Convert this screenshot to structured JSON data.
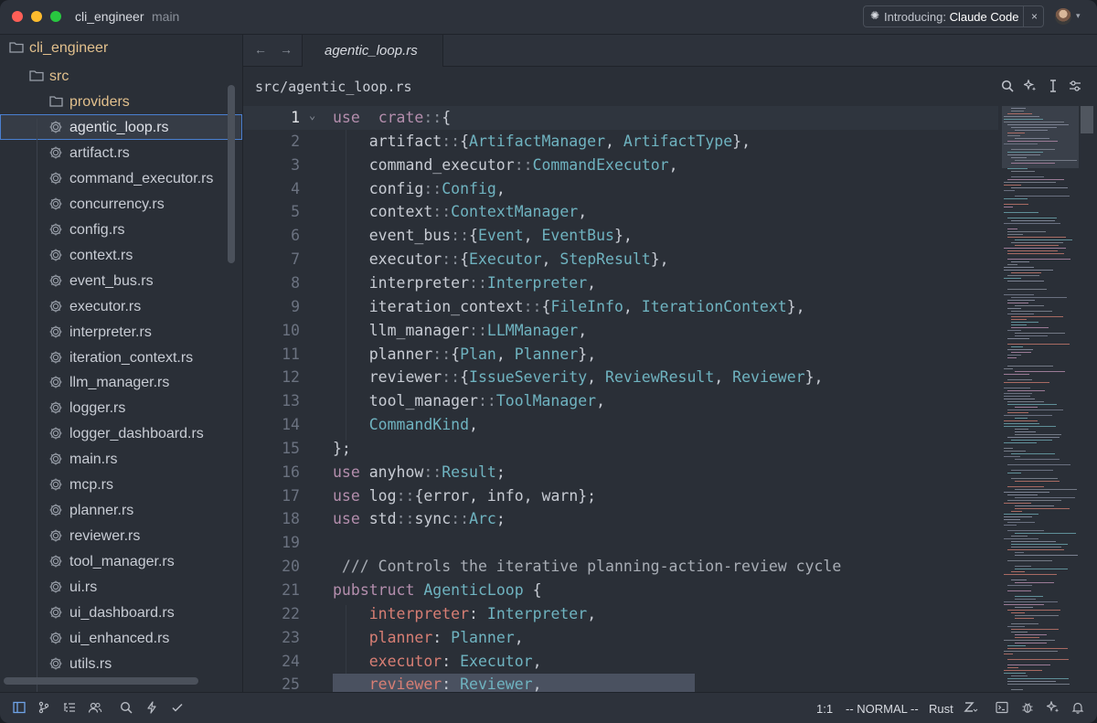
{
  "titlebar": {
    "project": "cli_engineer",
    "branch": "main",
    "announcement_prefix": "Introducing:",
    "announcement_title": "Claude Code",
    "close_glyph": "×"
  },
  "sidebar": {
    "root": "cli_engineer",
    "folder_src": "src",
    "items": [
      {
        "label": "providers",
        "type": "folder"
      },
      {
        "label": "agentic_loop.rs",
        "type": "file",
        "selected": true
      },
      {
        "label": "artifact.rs",
        "type": "file"
      },
      {
        "label": "command_executor.rs",
        "type": "file"
      },
      {
        "label": "concurrency.rs",
        "type": "file"
      },
      {
        "label": "config.rs",
        "type": "file"
      },
      {
        "label": "context.rs",
        "type": "file"
      },
      {
        "label": "event_bus.rs",
        "type": "file"
      },
      {
        "label": "executor.rs",
        "type": "file"
      },
      {
        "label": "interpreter.rs",
        "type": "file"
      },
      {
        "label": "iteration_context.rs",
        "type": "file"
      },
      {
        "label": "llm_manager.rs",
        "type": "file"
      },
      {
        "label": "logger.rs",
        "type": "file"
      },
      {
        "label": "logger_dashboard.rs",
        "type": "file"
      },
      {
        "label": "main.rs",
        "type": "file"
      },
      {
        "label": "mcp.rs",
        "type": "file"
      },
      {
        "label": "planner.rs",
        "type": "file"
      },
      {
        "label": "reviewer.rs",
        "type": "file"
      },
      {
        "label": "tool_manager.rs",
        "type": "file"
      },
      {
        "label": "ui.rs",
        "type": "file"
      },
      {
        "label": "ui_dashboard.rs",
        "type": "file"
      },
      {
        "label": "ui_enhanced.rs",
        "type": "file"
      },
      {
        "label": "utils.rs",
        "type": "file"
      }
    ]
  },
  "editor": {
    "tab_label": "agentic_loop.rs",
    "breadcrumb": "src/agentic_loop.rs",
    "lines": [
      {
        "n": "1",
        "parts": [
          [
            "kw",
            "use"
          ],
          [
            "",
            "  "
          ],
          [
            "kw",
            "crate"
          ],
          [
            "op",
            "::"
          ],
          [
            "",
            "{"
          ]
        ]
      },
      {
        "n": "2",
        "parts": [
          [
            "",
            "    artifact"
          ],
          [
            "op",
            "::"
          ],
          [
            "",
            "{"
          ],
          [
            "ty",
            "ArtifactManager"
          ],
          [
            "",
            ", "
          ],
          [
            "ty",
            "ArtifactType"
          ],
          [
            "",
            "},"
          ]
        ]
      },
      {
        "n": "3",
        "parts": [
          [
            "",
            "    command_executor"
          ],
          [
            "op",
            "::"
          ],
          [
            "ty",
            "CommandExecutor"
          ],
          [
            "",
            ","
          ]
        ]
      },
      {
        "n": "4",
        "parts": [
          [
            "",
            "    config"
          ],
          [
            "op",
            "::"
          ],
          [
            "ty",
            "Config"
          ],
          [
            "",
            ","
          ]
        ]
      },
      {
        "n": "5",
        "parts": [
          [
            "",
            "    context"
          ],
          [
            "op",
            "::"
          ],
          [
            "ty",
            "ContextManager"
          ],
          [
            "",
            ","
          ]
        ]
      },
      {
        "n": "6",
        "parts": [
          [
            "",
            "    event_bus"
          ],
          [
            "op",
            "::"
          ],
          [
            "",
            "{"
          ],
          [
            "ty",
            "Event"
          ],
          [
            "",
            ", "
          ],
          [
            "ty",
            "EventBus"
          ],
          [
            "",
            "},"
          ]
        ]
      },
      {
        "n": "7",
        "parts": [
          [
            "",
            "    executor"
          ],
          [
            "op",
            "::"
          ],
          [
            "",
            "{"
          ],
          [
            "ty",
            "Executor"
          ],
          [
            "",
            ", "
          ],
          [
            "ty",
            "StepResult"
          ],
          [
            "",
            "},"
          ]
        ]
      },
      {
        "n": "8",
        "parts": [
          [
            "",
            "    interpreter"
          ],
          [
            "op",
            "::"
          ],
          [
            "ty",
            "Interpreter"
          ],
          [
            "",
            ","
          ]
        ]
      },
      {
        "n": "9",
        "parts": [
          [
            "",
            "    iteration_context"
          ],
          [
            "op",
            "::"
          ],
          [
            "",
            "{"
          ],
          [
            "ty",
            "FileInfo"
          ],
          [
            "",
            ", "
          ],
          [
            "ty",
            "IterationContext"
          ],
          [
            "",
            "},"
          ]
        ]
      },
      {
        "n": "10",
        "parts": [
          [
            "",
            "    llm_manager"
          ],
          [
            "op",
            "::"
          ],
          [
            "ty",
            "LLMManager"
          ],
          [
            "",
            ","
          ]
        ]
      },
      {
        "n": "11",
        "parts": [
          [
            "",
            "    planner"
          ],
          [
            "op",
            "::"
          ],
          [
            "",
            "{"
          ],
          [
            "ty",
            "Plan"
          ],
          [
            "",
            ", "
          ],
          [
            "ty",
            "Planner"
          ],
          [
            "",
            "},"
          ]
        ]
      },
      {
        "n": "12",
        "parts": [
          [
            "",
            "    reviewer"
          ],
          [
            "op",
            "::"
          ],
          [
            "",
            "{"
          ],
          [
            "ty",
            "IssueSeverity"
          ],
          [
            "",
            ", "
          ],
          [
            "ty",
            "ReviewResult"
          ],
          [
            "",
            ", "
          ],
          [
            "ty",
            "Reviewer"
          ],
          [
            "",
            "},"
          ]
        ]
      },
      {
        "n": "13",
        "parts": [
          [
            "",
            "    tool_manager"
          ],
          [
            "op",
            "::"
          ],
          [
            "ty",
            "ToolManager"
          ],
          [
            "",
            ","
          ]
        ]
      },
      {
        "n": "14",
        "parts": [
          [
            "",
            "    "
          ],
          [
            "ty",
            "CommandKind"
          ],
          [
            "",
            ","
          ]
        ]
      },
      {
        "n": "15",
        "parts": [
          [
            "",
            "};"
          ]
        ]
      },
      {
        "n": "16",
        "parts": [
          [
            "kw",
            "use"
          ],
          [
            "",
            " anyhow"
          ],
          [
            "op",
            "::"
          ],
          [
            "ty",
            "Result"
          ],
          [
            "",
            ";"
          ]
        ]
      },
      {
        "n": "17",
        "parts": [
          [
            "kw",
            "use"
          ],
          [
            "",
            " log"
          ],
          [
            "op",
            "::"
          ],
          [
            "",
            "{error, info, warn};"
          ]
        ]
      },
      {
        "n": "18",
        "parts": [
          [
            "kw",
            "use"
          ],
          [
            "",
            " std"
          ],
          [
            "op",
            "::"
          ],
          [
            "",
            "sync"
          ],
          [
            "op",
            "::"
          ],
          [
            "ty",
            "Arc"
          ],
          [
            "",
            ";"
          ]
        ]
      },
      {
        "n": "19",
        "parts": []
      },
      {
        "n": "20",
        "parts": [
          [
            "cm",
            " /// Controls the iterative planning-action-review cycle"
          ]
        ]
      },
      {
        "n": "21",
        "parts": [
          [
            "kw",
            "pub"
          ],
          [
            "",
            "",
            " "
          ],
          [
            "kw",
            "struct"
          ],
          [
            "",
            " "
          ],
          [
            "ty",
            "AgenticLoop"
          ],
          [
            "",
            " {"
          ]
        ]
      },
      {
        "n": "22",
        "parts": [
          [
            "",
            "    "
          ],
          [
            "fld",
            "interpreter"
          ],
          [
            "",
            ": "
          ],
          [
            "ty",
            "Interpreter"
          ],
          [
            "",
            ","
          ]
        ]
      },
      {
        "n": "23",
        "parts": [
          [
            "",
            "    "
          ],
          [
            "fld",
            "planner"
          ],
          [
            "",
            ": "
          ],
          [
            "ty",
            "Planner"
          ],
          [
            "",
            ","
          ]
        ]
      },
      {
        "n": "24",
        "parts": [
          [
            "",
            "    "
          ],
          [
            "fld",
            "executor"
          ],
          [
            "",
            ": "
          ],
          [
            "ty",
            "Executor"
          ],
          [
            "",
            ","
          ]
        ]
      },
      {
        "n": "25",
        "parts": [
          [
            "",
            "    "
          ],
          [
            "fld",
            "reviewer"
          ],
          [
            "",
            ": "
          ],
          [
            "ty",
            "Reviewer"
          ],
          [
            "",
            ","
          ]
        ]
      }
    ]
  },
  "statusbar": {
    "cursor": "1:1",
    "mode": "-- NORMAL --",
    "language": "Rust"
  },
  "colors": {
    "keyword": "#b48ead",
    "type": "#6fb3c0",
    "field": "#d77e74",
    "folder": "#e2c08d",
    "selection_border": "#4a7fd0"
  },
  "icons": {
    "titlebar": [
      "sparkle-icon",
      "close-icon",
      "avatar",
      "chevron-down-icon"
    ],
    "editor_tools": [
      "search-icon",
      "assistant-sparkle-icon",
      "text-cursor-icon",
      "settings-sliders-icon"
    ],
    "status_left": [
      "project-panel-icon",
      "git-branch-icon",
      "outline-icon",
      "collab-icon",
      "search-icon",
      "bolt-icon",
      "check-icon"
    ],
    "status_right": [
      "zed-icon",
      "terminal-icon",
      "debug-icon",
      "ai-sparkle-icon",
      "notification-bell-icon"
    ]
  }
}
